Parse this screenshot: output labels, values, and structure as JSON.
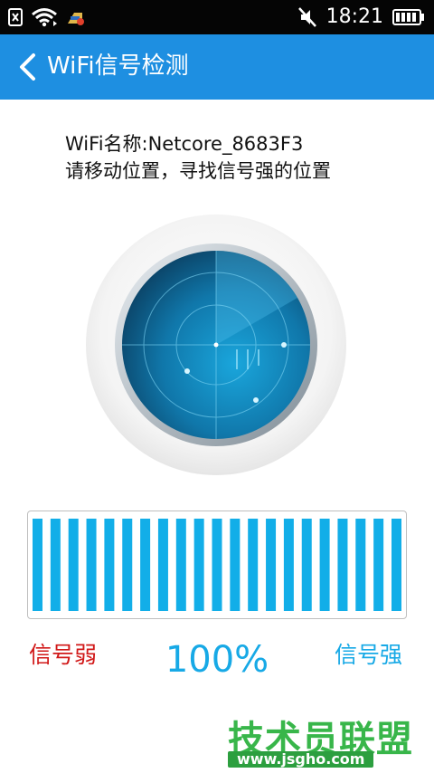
{
  "status_bar": {
    "time": "18:21",
    "icons": [
      "notification-x-icon",
      "wifi-icon",
      "app-notification-icon",
      "mute-icon",
      "battery-icon"
    ]
  },
  "app_bar": {
    "title": "WiFi信号检测",
    "back_icon": "chevron-left-icon",
    "color": "#1e8fe1"
  },
  "info": {
    "wifi_name_line": "WiFi名称:Netcore_8683F3",
    "hint": "请移动位置，寻找信号强的位置"
  },
  "signal": {
    "level": 1.0,
    "bar_count": 21,
    "bar_color": "#12aee8",
    "weak_label": "信号弱",
    "strong_label": "信号强",
    "percent": "100%"
  },
  "watermark": {
    "title": "技术员联盟",
    "url": "www.jsgho.com"
  }
}
